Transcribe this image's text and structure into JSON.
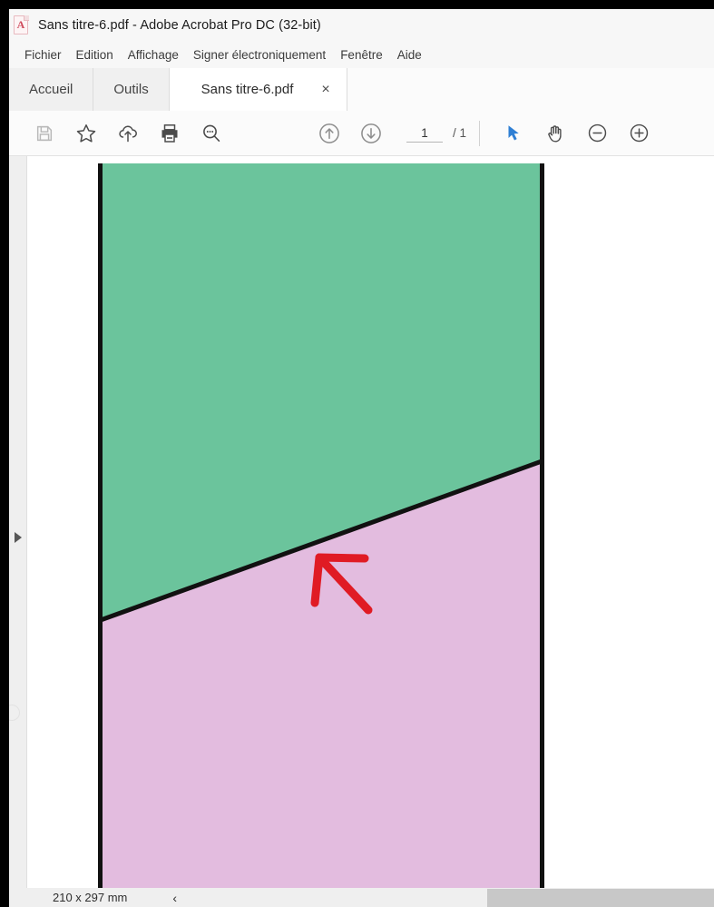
{
  "window": {
    "title": "Sans titre-6.pdf - Adobe Acrobat Pro DC (32-bit)",
    "app_icon": "pdf-document-icon",
    "pdf_glyph": "A"
  },
  "menubar": {
    "items": [
      {
        "label": "Fichier"
      },
      {
        "label": "Edition"
      },
      {
        "label": "Affichage"
      },
      {
        "label": "Signer électroniquement"
      },
      {
        "label": "Fenêtre"
      },
      {
        "label": "Aide"
      }
    ]
  },
  "tabs": {
    "home_label": "Accueil",
    "tools_label": "Outils",
    "document_label": "Sans titre-6.pdf",
    "close_glyph": "×"
  },
  "toolbar": {
    "save_icon": "floppy-save-icon",
    "bookmark_icon": "star-icon",
    "upload_icon": "cloud-upload-icon",
    "print_icon": "printer-icon",
    "search_icon": "magnifier-text-icon",
    "previous_page_icon": "arrow-up-circle-icon",
    "next_page_icon": "arrow-down-circle-icon",
    "page_number": "1",
    "page_total": "/ 1",
    "select_tool_icon": "cursor-arrow-icon",
    "hand_tool_icon": "hand-icon",
    "zoom_out_icon": "minus-circle-icon",
    "zoom_in_icon": "plus-circle-icon",
    "accent_color": "#2f7fd4"
  },
  "sidebar": {
    "expand_icon": "expand-panel-triangle-icon"
  },
  "document": {
    "shapes": [
      {
        "name": "upper-region",
        "fill": "#6bc49c",
        "outline": "#111111"
      },
      {
        "name": "lower-region",
        "fill": "#e3bcdf",
        "outline": "#111111"
      }
    ],
    "annotation": {
      "name": "red-arrow-annotation",
      "color": "#e01b24",
      "direction": "up-left"
    }
  },
  "statusbar": {
    "page_size": "210 x 297 mm",
    "collapse_glyph": "‹"
  }
}
